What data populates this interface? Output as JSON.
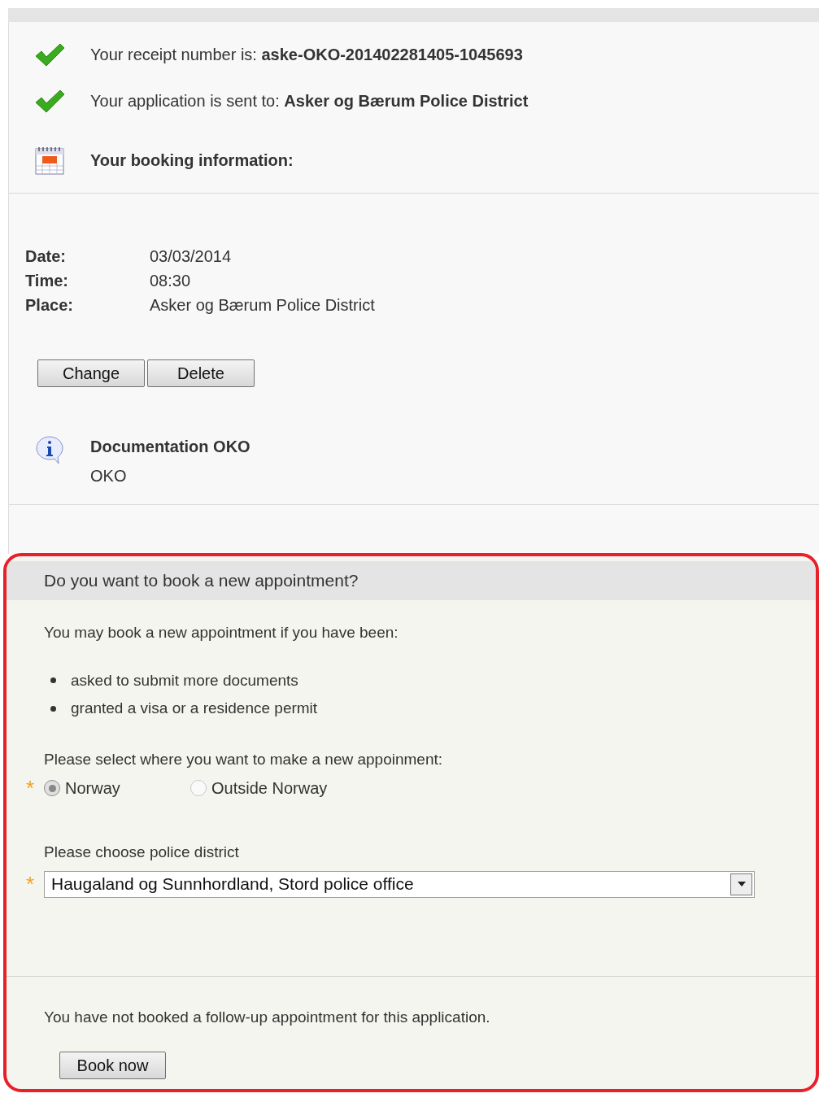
{
  "status_lines": [
    {
      "kind": "check",
      "text": "Your receipt number is: **aske-OKO-201402281405-1045693**"
    },
    {
      "kind": "check",
      "text": "Your application is sent to: **Asker og Bærum Police District**"
    },
    {
      "kind": "calendar",
      "text": "**Your booking information:**"
    }
  ],
  "booking": [
    {
      "label": "Date:",
      "value": "03/03/2014"
    },
    {
      "label": "Time:",
      "value": "08:30"
    },
    {
      "label": "Place:",
      "value": "Asker og Bærum Police District"
    }
  ],
  "booking_buttons": [
    "Change",
    "Delete"
  ],
  "documentation": {
    "title": "Documentation OKO",
    "subtitle": "OKO"
  },
  "new_appointment": {
    "title": "Do you want to book a new appointment?",
    "intro": "You may book a new appointment if you have been:",
    "reasons": [
      "asked to submit more documents",
      "granted a visa or a residence permit"
    ],
    "location_prompt": "Please select where you want to make a new appoinment:",
    "location_required_mark": "*",
    "locations": [
      {
        "label": "Norway",
        "selected": true
      },
      {
        "label": "Outside Norway",
        "selected": false
      }
    ],
    "district_prompt": "Please choose police district",
    "district_required_mark": "*",
    "district_value": "Haugaland og Sunnhordland, Stord police office",
    "note": "You have not booked a follow-up appointment for this application.",
    "book_button": "Book now"
  }
}
